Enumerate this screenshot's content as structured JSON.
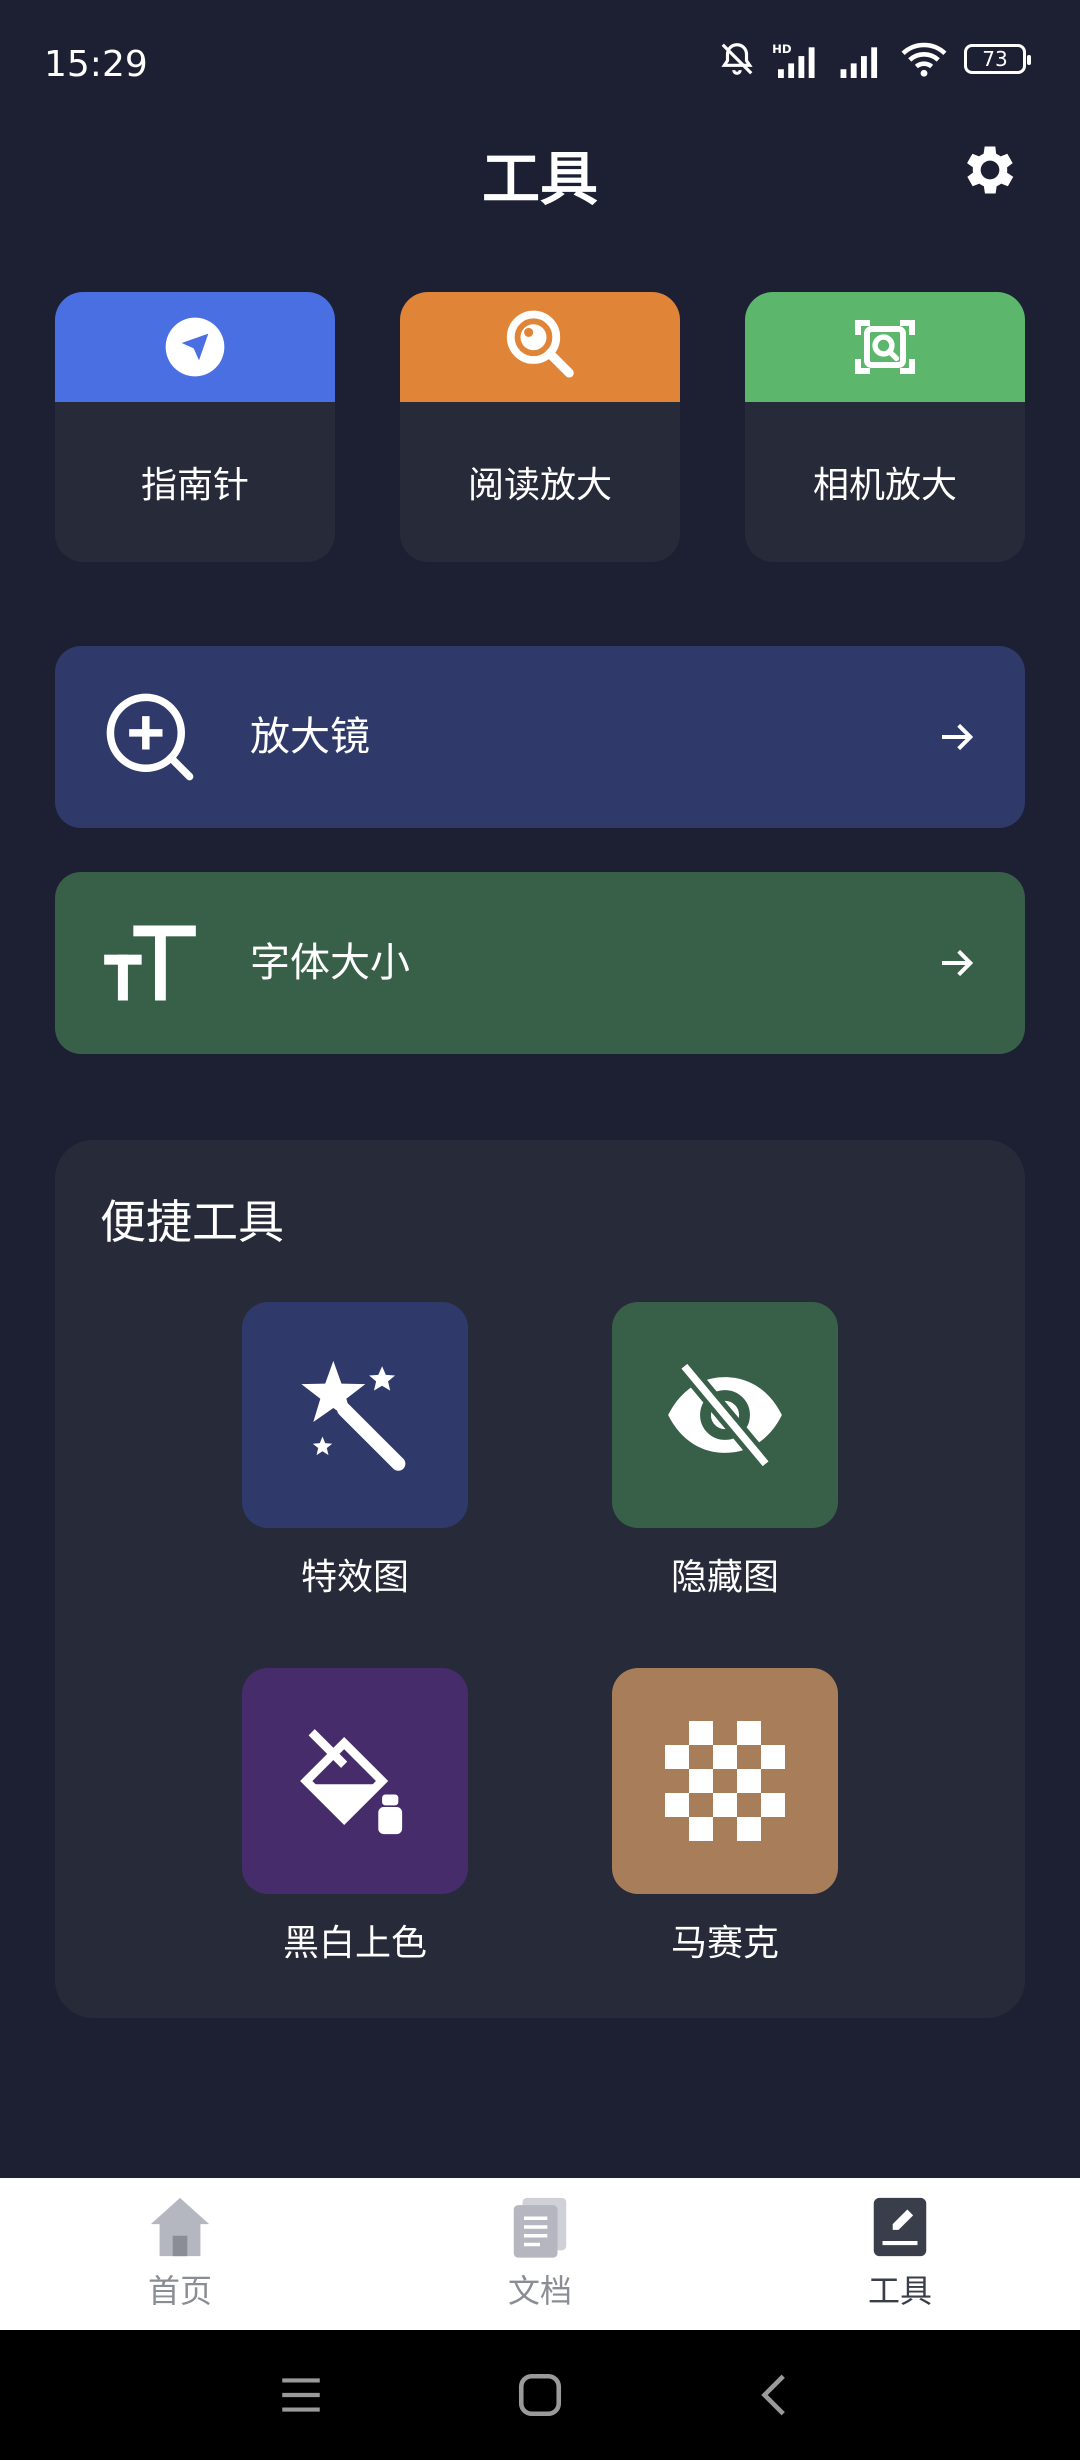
{
  "status_bar": {
    "time": "15:29",
    "battery": "73",
    "icons": [
      "mute-bell-icon",
      "hd-signal-icon",
      "signal-icon",
      "wifi-icon",
      "battery-icon"
    ]
  },
  "header": {
    "title": "工具",
    "settings_icon": "gear-icon"
  },
  "top_cards": [
    {
      "label": "指南针",
      "icon": "compass-icon",
      "color": "#4a6fe3"
    },
    {
      "label": "阅读放大",
      "icon": "magnifier-icon",
      "color": "#e08437"
    },
    {
      "label": "相机放大",
      "icon": "camera-scan-icon",
      "color": "#5cb76d"
    }
  ],
  "rows": [
    {
      "label": "放大镜",
      "icon": "zoom-in-icon",
      "color": "#2f3a6b"
    },
    {
      "label": "字体大小",
      "icon": "font-size-icon",
      "color": "#385f47"
    }
  ],
  "quick_tools": {
    "title": "便捷工具",
    "items": [
      {
        "label": "特效图",
        "icon": "magic-wand-icon",
        "color": "#2f3a6b"
      },
      {
        "label": "隐藏图",
        "icon": "eye-hidden-icon",
        "color": "#385f47"
      },
      {
        "label": "黑白上色",
        "icon": "paint-bucket-icon",
        "color": "#472c6b"
      },
      {
        "label": "马赛克",
        "icon": "mosaic-icon",
        "color": "#a77e59"
      }
    ]
  },
  "bottom_nav": {
    "items": [
      {
        "label": "首页",
        "icon": "home-icon",
        "active": false
      },
      {
        "label": "文档",
        "icon": "document-icon",
        "active": false
      },
      {
        "label": "工具",
        "icon": "tools-icon",
        "active": true
      }
    ]
  },
  "system_nav": [
    "menu-icon",
    "home-square-icon",
    "back-icon"
  ]
}
